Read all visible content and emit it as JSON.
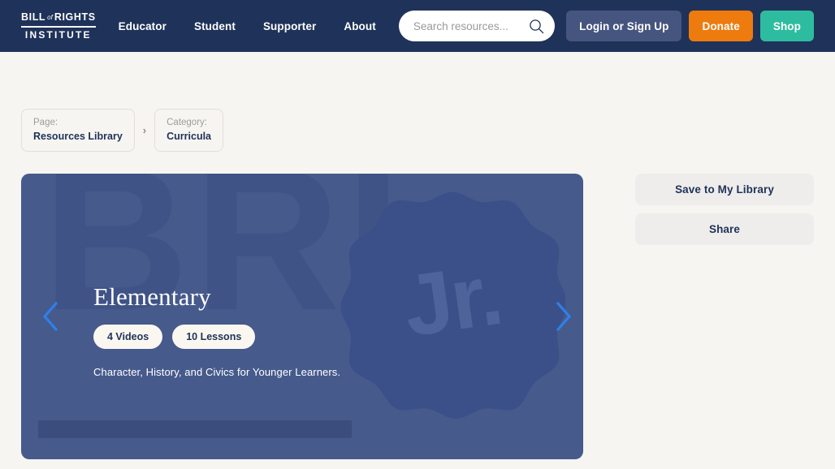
{
  "header": {
    "logo": {
      "line1_left": "BILL",
      "line1_mid": "of",
      "line1_right": "RIGHTS",
      "line2": "INSTITUTE"
    },
    "nav": [
      {
        "label": "Educator"
      },
      {
        "label": "Student"
      },
      {
        "label": "Supporter"
      },
      {
        "label": "About"
      }
    ],
    "search": {
      "placeholder": "Search resources...",
      "value": "",
      "icon": "search-icon"
    },
    "actions": {
      "login": "Login or Sign Up",
      "donate": "Donate",
      "shop": "Shop"
    },
    "colors": {
      "background": "#1f3259",
      "login": "#46557f",
      "donate": "#ed7b0e",
      "shop": "#2ebca0"
    }
  },
  "breadcrumb": {
    "separator": "›",
    "items": [
      {
        "label": "Page:",
        "value": "Resources Library"
      },
      {
        "label": "Category:",
        "value": "Curricula"
      }
    ]
  },
  "hero": {
    "watermark": "BRI",
    "badge_text": "Jr.",
    "title": "Elementary",
    "pills": [
      {
        "label": "4 Videos"
      },
      {
        "label": "10 Lessons"
      }
    ],
    "description": "Character, History, and Civics for Younger Learners.",
    "prev_icon": "chevron-left-icon",
    "next_icon": "chevron-right-icon",
    "colors": {
      "background": "#465a8c",
      "watermark": "#3f5386",
      "badge": "#3b5088",
      "arrow": "#2f7fe8"
    }
  },
  "rail": {
    "buttons": [
      {
        "label": "Save to My Library"
      },
      {
        "label": "Share"
      }
    ]
  }
}
